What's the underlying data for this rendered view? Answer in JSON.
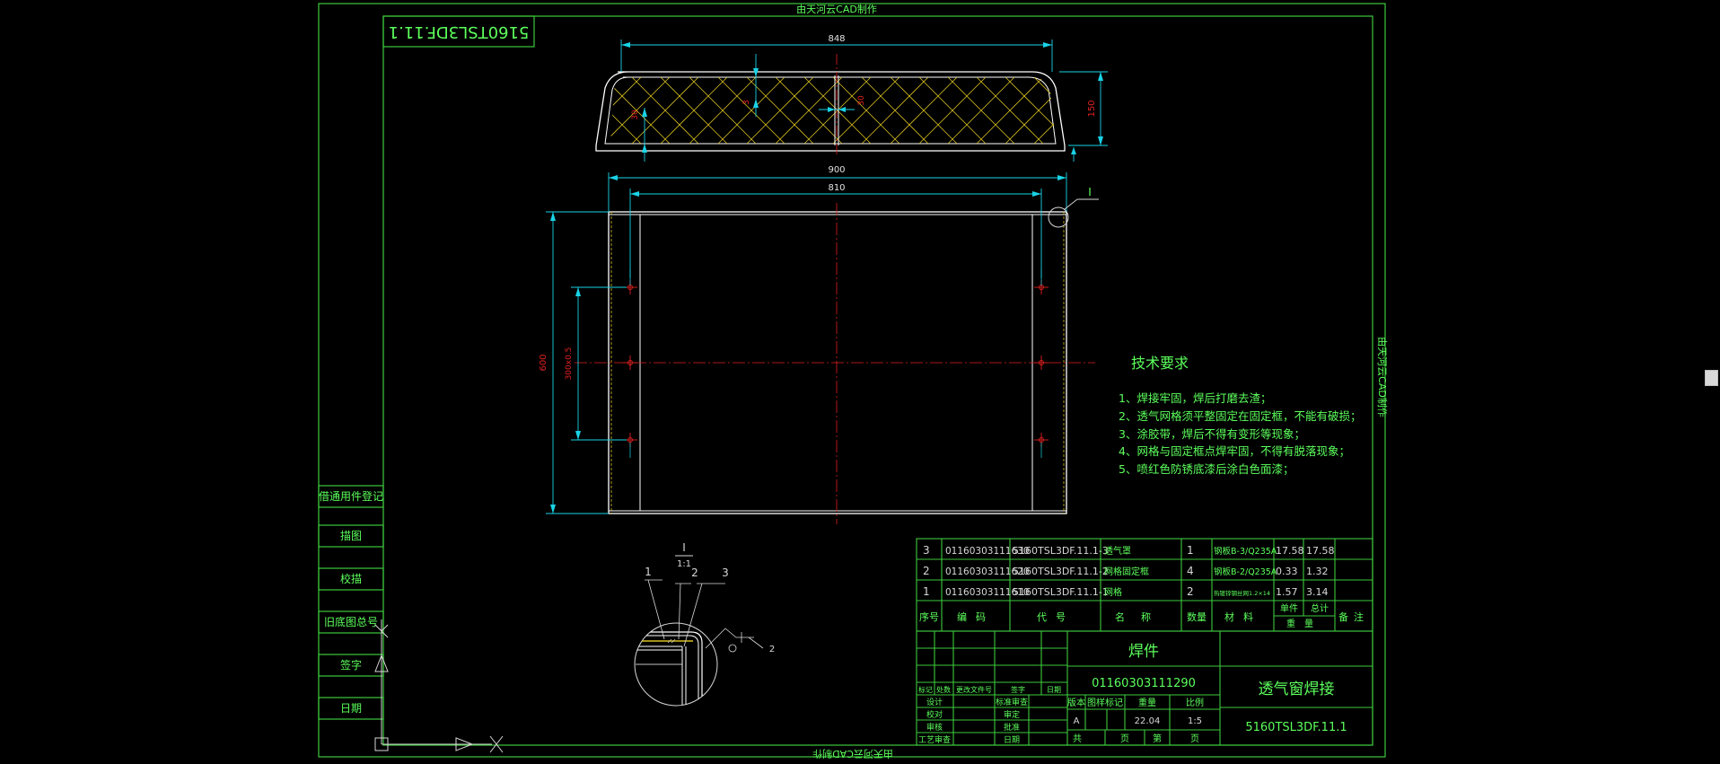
{
  "colors": {
    "frame": "#3cc93c",
    "outline": "#ffffff",
    "centerline": "#e02020",
    "dimension": "#19d3e6",
    "dimension_text": "#e2e2e2",
    "hatch": "#d8c020",
    "annotation": "#5cff5c",
    "leader": "#d8d8d8",
    "background": "#000000"
  },
  "watermark": "由天河云CAD制作",
  "drawing_number_mirrored": "5160TSL3DF.11.1",
  "detail_marker": "I",
  "detail_view": {
    "label": "I",
    "scale": "1:1",
    "callouts": [
      "1",
      "2",
      "3"
    ],
    "weld_symbol": "2"
  },
  "dimensions": {
    "top_width": "848",
    "top_height": "150",
    "top_hatch_1": "30",
    "top_hatch_2": "3",
    "top_hatch_3": "30",
    "mid_total": "900",
    "mid_inner": "810",
    "left_height": "600",
    "left_hole_spacing": "300x0.5"
  },
  "tech_requirements": {
    "title": "技术要求",
    "items": [
      "1、焊接牢固，焊后打磨去渣；",
      "2、透气网格须平整固定在固定框，不能有破损；",
      "3、涂胶带，焊后不得有变形等现象；",
      "4、网格与固定框点焊牢固，不得有脱落现象；",
      "5、喷红色防锈底漆后涂白色面漆；"
    ]
  },
  "side_boxes": [
    "借通用件登记",
    "描图",
    "校描",
    "旧底图总号",
    "签字",
    "日期"
  ],
  "bom": {
    "rows": [
      {
        "no": "3",
        "code": "01160303111630",
        "part": "5160TSL3DF.11.1-3",
        "name": "透气罩",
        "qty": "1",
        "material": "钢板B-3/Q235A",
        "unit": "17.58",
        "total": "17.58"
      },
      {
        "no": "2",
        "code": "01160303111620",
        "part": "5160TSL3DF.11.1-2",
        "name": "网格固定框",
        "qty": "4",
        "material": "钢板B-2/Q235A",
        "unit": "0.33",
        "total": "1.32"
      },
      {
        "no": "1",
        "code": "01160303111610",
        "part": "5160TSL3DF.11.1-1",
        "name": "网格",
        "qty": "2",
        "material": "热镀锌钢丝网1.2×14",
        "unit": "1.57",
        "total": "3.14"
      }
    ],
    "headers": {
      "no": "序号",
      "code": "编码",
      "part": "代号",
      "name": "名称",
      "qty": "数量",
      "material": "材料",
      "unit": "单件",
      "total": "总计",
      "weight": "重量",
      "remark": "备注"
    }
  },
  "title_block": {
    "type": "焊件",
    "part_code": "01160303111290",
    "title": "透气窗焊接",
    "drawing_no": "5160TSL3DF.11.1",
    "rev_headers": [
      "标记",
      "处数",
      "更改文件号",
      "签字",
      "日期"
    ],
    "roles": [
      "设计",
      "校对",
      "审核",
      "工艺审查"
    ],
    "roles2": [
      "标准审查",
      "审定",
      "批准",
      "日期"
    ],
    "stage_headers": [
      "版本",
      "图样标记",
      "重量",
      "比例"
    ],
    "stage_values": [
      "A",
      "",
      "22.04",
      "1:5"
    ],
    "sheet": [
      "共",
      "页",
      "第",
      "页"
    ]
  }
}
